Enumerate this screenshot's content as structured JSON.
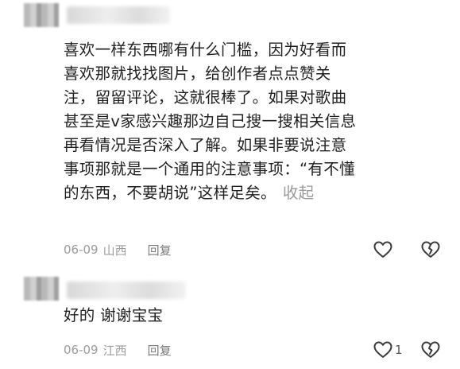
{
  "comments": [
    {
      "lines": [
        "喜欢一样东西哪有什么门槛，因为好看而",
        "喜欢那就找找图片，给创作者点点赞关",
        "注，留留评论，这就很棒了。如果对歌曲",
        "甚至是v家感兴趣那边自己搜一搜相关信息",
        "再看情况是否深入了解。如果非要说注意",
        "事项那就是一个通用的注意事项：“有不懂",
        "的东西，不要胡说”这样足矣。"
      ],
      "collapse_label": "收起",
      "date": "06-09",
      "location": "山西",
      "reply_label": "回复",
      "like_count": ""
    },
    {
      "lines": [
        "好的 谢谢宝宝"
      ],
      "date": "06-09",
      "location": "江西",
      "reply_label": "回复",
      "like_count": "1"
    }
  ],
  "icons": {
    "like": "heart-outline-icon",
    "dislike": "broken-heart-outline-icon"
  }
}
